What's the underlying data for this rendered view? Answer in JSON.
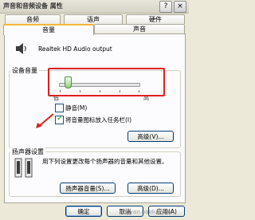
{
  "window": {
    "title": "声音和音频设备 属性",
    "help_label": "?",
    "close_label": "×"
  },
  "tabs": {
    "row1": [
      "音频",
      "语声",
      "硬件"
    ],
    "row2": [
      "音量",
      "声音"
    ],
    "active": "音量"
  },
  "device": {
    "name": "Realtek HD Audio output",
    "icon": "speaker-icon"
  },
  "device_volume": {
    "legend": "设备音量",
    "slider_low": "低",
    "slider_high": "高",
    "level_fraction": 0.1,
    "mute_label": "静音(M)",
    "mute_checked": false,
    "tray_label": "将音量图标放入任务栏(I)",
    "tray_checked": true,
    "advanced_button": "高级(V)..."
  },
  "speaker_settings": {
    "legend": "扬声器设置",
    "description": "用下列设置更改每个扬声器的音量和其他设置。",
    "volume_button": "扬声器音量(S)...",
    "advanced_button": "高级(D)..."
  },
  "footer": {
    "ok": "确定",
    "cancel": "取消",
    "apply": "应用(A)"
  },
  "watermark": "jingyan.baidu.com",
  "colors": {
    "highlight_box": "#e0201e",
    "tab_accent": "#f4b73a"
  }
}
